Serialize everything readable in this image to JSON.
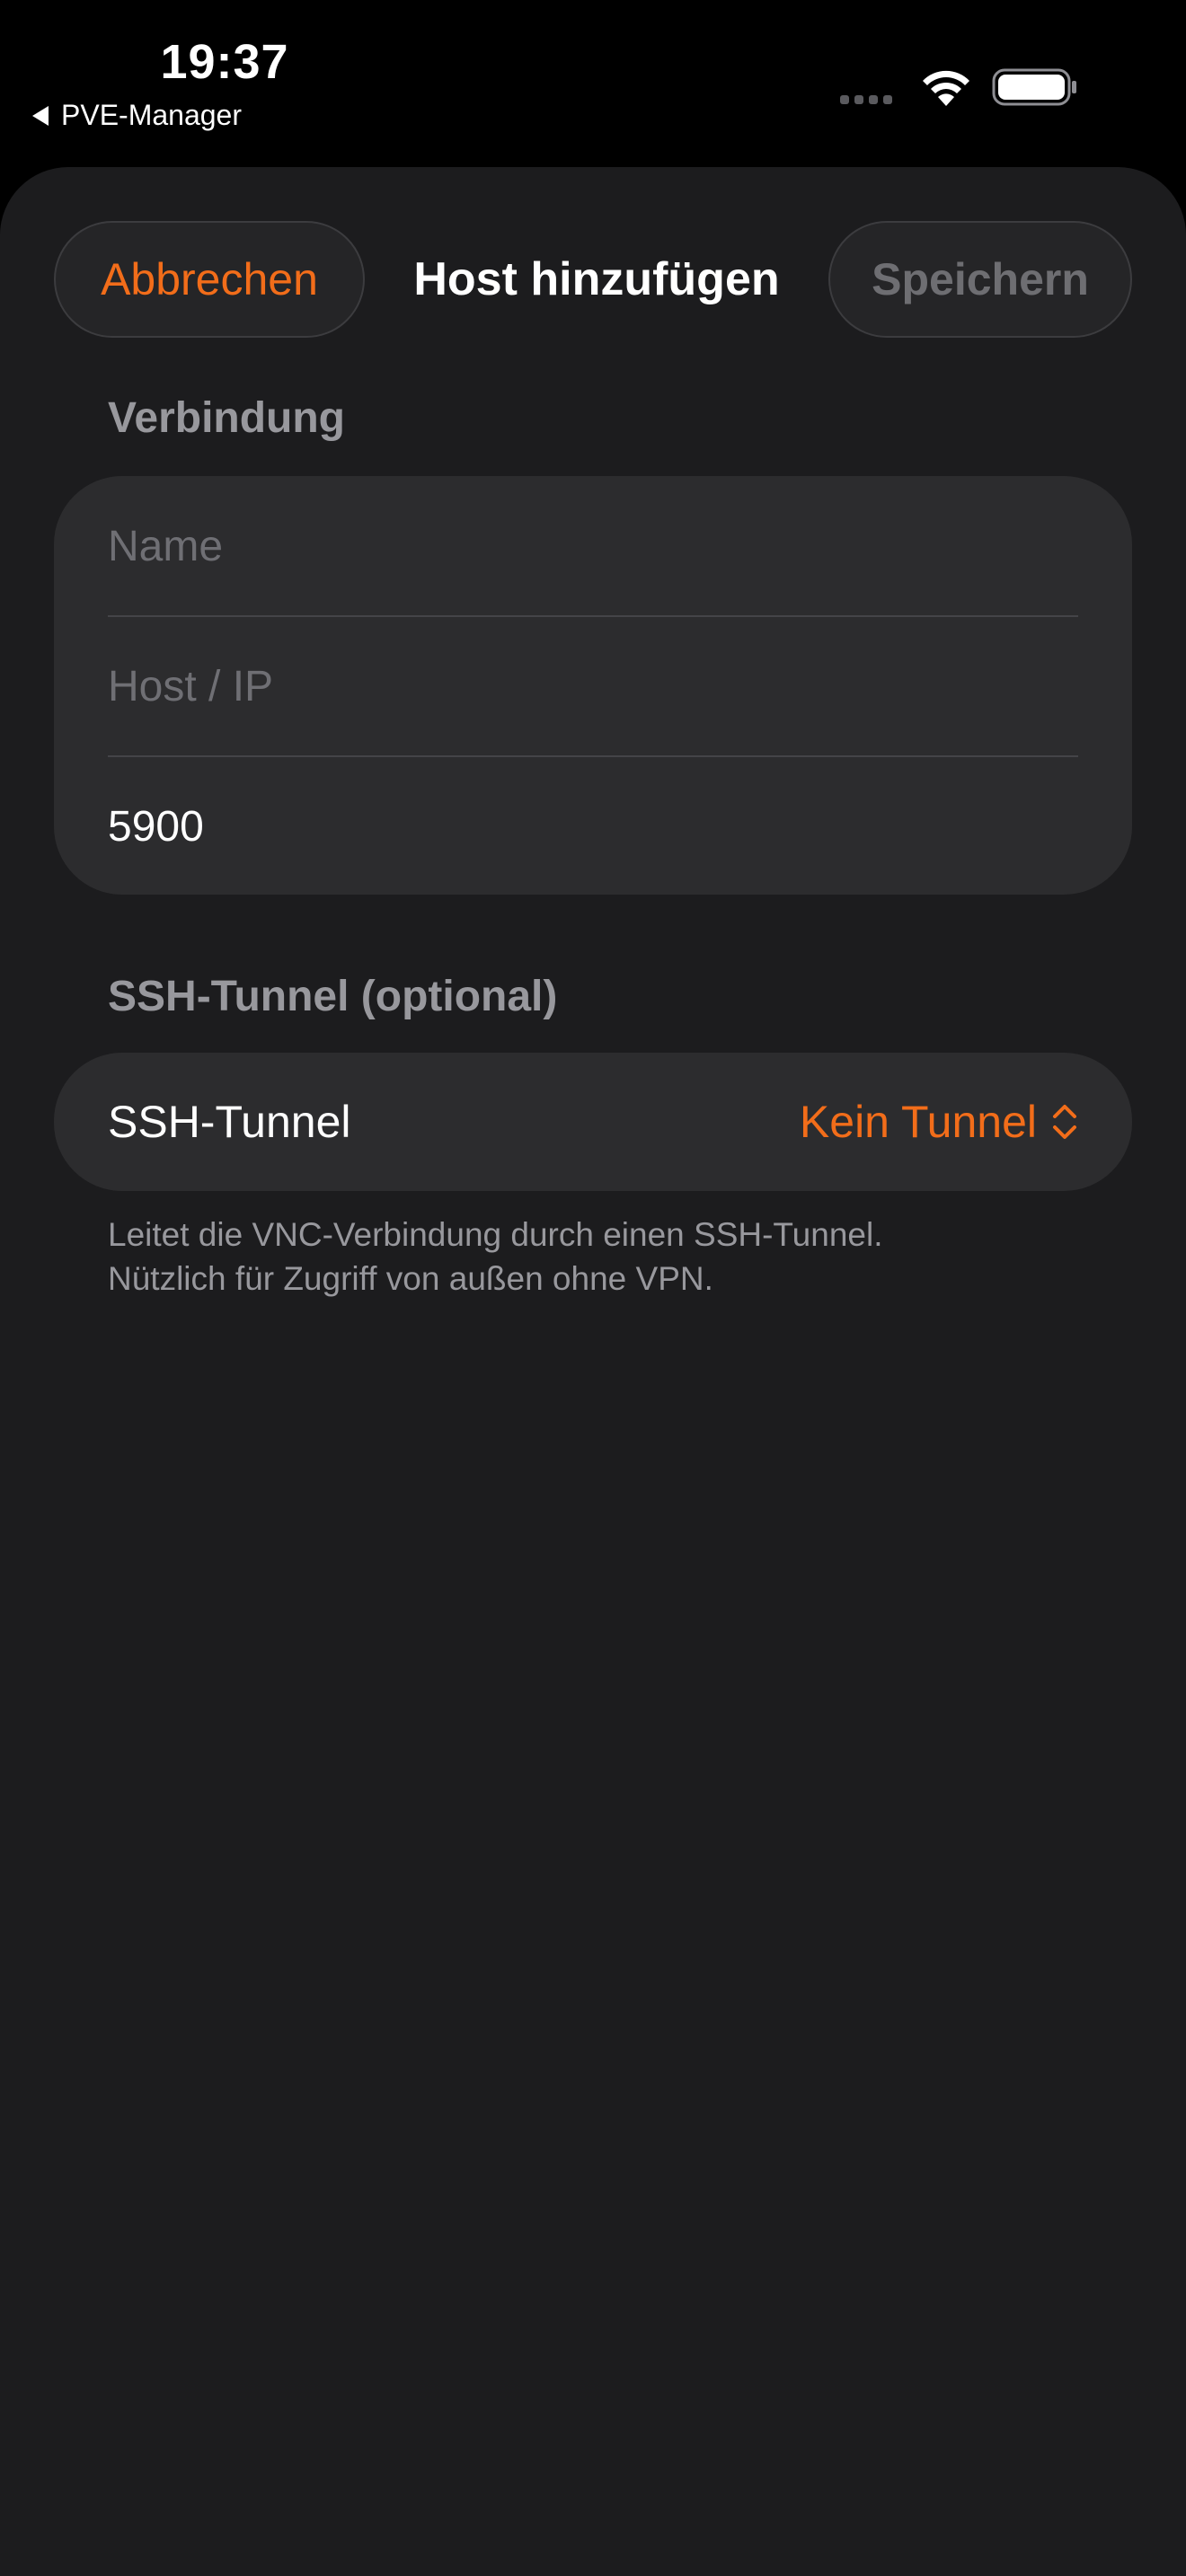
{
  "status_bar": {
    "time": "19:37",
    "back_app": "PVE-Manager"
  },
  "nav": {
    "cancel_label": "Abbrechen",
    "title": "Host hinzufügen",
    "save_label": "Speichern"
  },
  "connection": {
    "header": "Verbindung",
    "name_placeholder": "Name",
    "host_placeholder": "Host / IP",
    "port_value": "5900"
  },
  "ssh": {
    "header": "SSH-Tunnel (optional)",
    "row_label": "SSH-Tunnel",
    "selected_option": "Kein Tunnel",
    "footer_line1": "Leitet die VNC-Verbindung durch einen SSH-Tunnel.",
    "footer_line2": "Nützlich für Zugriff von außen ohne VPN."
  },
  "colors": {
    "accent": "#f26d1a",
    "background": "#1c1c1e",
    "group_background": "#2c2c2e",
    "secondary_text": "#98989d"
  },
  "icons": {
    "wifi": "wifi-icon",
    "battery": "battery-icon",
    "cellular": "cellular-dots-icon",
    "back": "back-triangle-icon",
    "picker": "chevron-up-down-icon"
  }
}
